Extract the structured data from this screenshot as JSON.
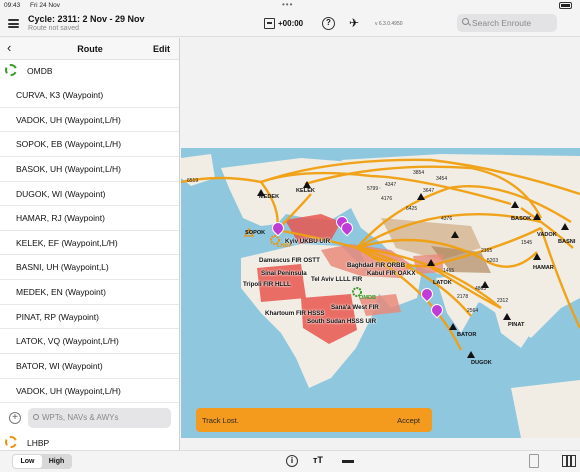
{
  "status": {
    "time": "09:43",
    "date": "Fri 24 Nov",
    "dots": "•••"
  },
  "header": {
    "cycle_title": "Cycle: 2311: 2 Nov - 29 Nov",
    "cycle_subtitle": "Route not saved",
    "time_offset": "+00:00",
    "help": "?",
    "plane_glyph": "✈",
    "version": "v 6.3.0.4950",
    "search_placeholder": "Search Enroute"
  },
  "sidebar": {
    "title": "Route",
    "edit": "Edit",
    "departure": "OMDB",
    "arrival": "LHBP",
    "waypoints": [
      "CURVA, K3 (Waypoint)",
      "VADOK, UH (Waypoint,L/H)",
      "SOPOK, EB (Waypoint,L/H)",
      "BASOK, UH (Waypoint,L/H)",
      "DUGOK, WI (Waypoint)",
      "HAMAR, RJ (Waypoint)",
      "KELEK, EF (Waypoint,L/H)",
      "BASNI, UH (Waypoint,L)",
      "MEDEK, EN (Waypoint)",
      "PINAT, RP (Waypoint)",
      "LATOK, VQ (Waypoint,L/H)",
      "BATOR, WI (Waypoint)",
      "VADOK, UH (Waypoint,L/H)"
    ],
    "add_placeholder": "WPTs, NAVs & AWYs"
  },
  "map": {
    "waypoint_labels": {
      "medek": "MEDEK",
      "kelek": "KELEK",
      "sopok": "SOPOK",
      "lhbp": "LHBP",
      "omdb": "OMDB",
      "basok": "BASOK",
      "vadok": "VADOK",
      "basni": "BASNI",
      "hamar": "HAMAR",
      "latok": "LATOK",
      "bator": "BATOR",
      "pinat": "PINAT",
      "dugok": "DUGOK"
    },
    "fir_labels": {
      "kyiv": "Kyiv UKBU UIR",
      "damascus": "Damascus FIR OSTT",
      "sinai": "Sinai Peninsula",
      "tel_aviv": "Tel Aviv LLLL FIR",
      "baghdad": "Baghdad FIR ORBB",
      "kabul": "Kabul FIR OAKX",
      "tripoli": "Tripoli FIR HLLL",
      "sanaa": "Sana'a West FIR",
      "khartoum": "Khartoum FIR HSSS",
      "south_sudan": "South Sudan HSSS UIR"
    },
    "distances": {
      "d6519": "6519",
      "d3854": "3854",
      "d3454": "3454",
      "d4347": "4347",
      "d3647": "3647",
      "d5799": "5799",
      "d4176": "4176",
      "d6425": "6425",
      "d4376": "4376",
      "d2178": "2178",
      "d4863": "4863",
      "d1465": "1465",
      "d5203": "5203",
      "d2312": "2312",
      "d2564": "2564",
      "d2165": "2165",
      "d1545": "1545"
    },
    "colors": {
      "route": "#f0a010",
      "danger": "#e8564f",
      "ocean": "#8fc7df",
      "land": "#f1ede4"
    }
  },
  "track": {
    "message": "Track Lost.",
    "accept": "Accept"
  },
  "bottombar": {
    "low": "Low",
    "high": "High",
    "info": "i",
    "text_tool": "ᴛT"
  }
}
